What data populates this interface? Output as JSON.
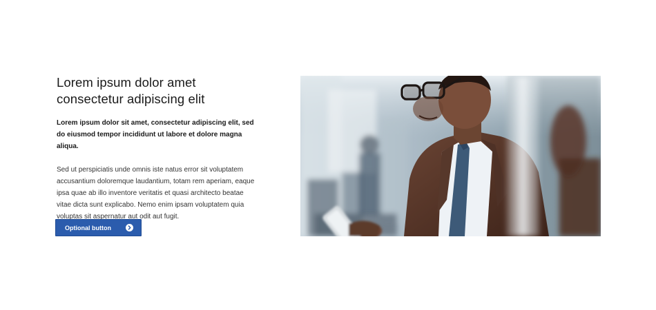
{
  "content": {
    "headline": "Lorem ipsum dolor amet consectetur adipiscing elit",
    "lead": "Lorem ipsum dolor sit amet, consectetur adipiscing elit, sed do eiusmod tempor incididunt ut labore et dolore magna aliqua.",
    "body": "Sed ut perspiciatis unde omnis iste natus error sit voluptatem accusantium doloremque laudantium, totam rem aperiam, eaque ipsa quae ab illo inventore veritatis et quasi architecto beatae vitae dicta sunt explicabo. Nemo enim ipsam voluptatem quia voluptas sit aspernatur aut odit aut fugit.",
    "button_label": "Optional button",
    "button_icon": "chevron-right-circle-icon"
  },
  "colors": {
    "button_bg": "#2b5cad",
    "text": "#1a1a1a"
  }
}
